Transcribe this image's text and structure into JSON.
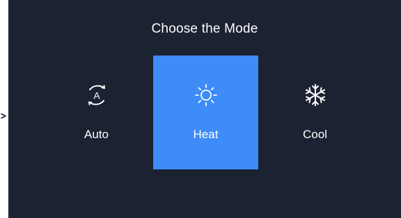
{
  "title": "Choose the Mode",
  "modes": [
    {
      "id": "auto",
      "label": "Auto",
      "icon": "auto-mode-icon",
      "selected": false
    },
    {
      "id": "heat",
      "label": "Heat",
      "icon": "sun-icon",
      "selected": true
    },
    {
      "id": "cool",
      "label": "Cool",
      "icon": "snowflake-icon",
      "selected": false
    }
  ],
  "colors": {
    "background": "#1b2231",
    "selected": "#3d8cf7",
    "text": "#ffffff"
  }
}
